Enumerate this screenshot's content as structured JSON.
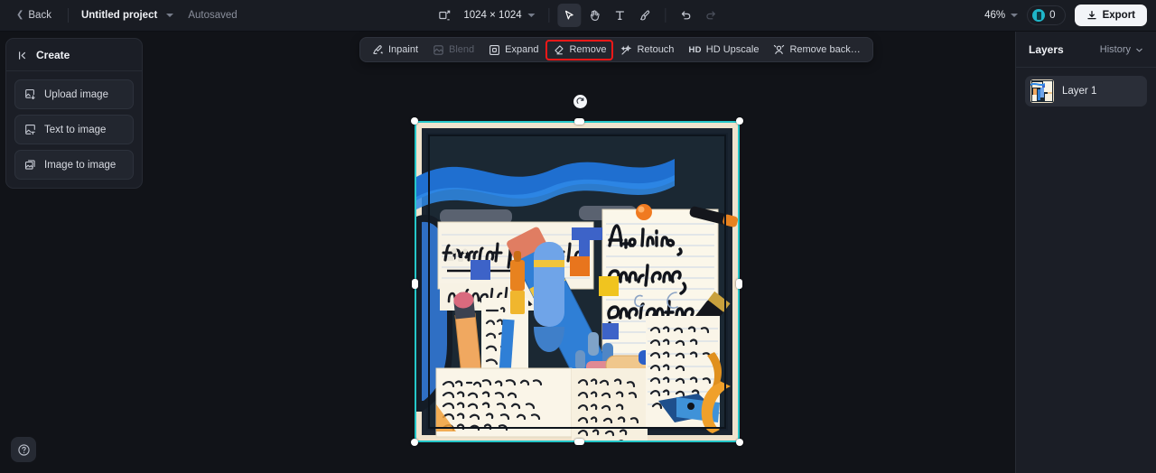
{
  "topbar": {
    "back_label": "Back",
    "project_name": "Untitled project",
    "autosave_label": "Autosaved",
    "canvas_size": "1024 × 1024",
    "zoom_level": "46%",
    "credits": "0",
    "export_label": "Export",
    "icons": {
      "resize": "resize-canvas-icon",
      "select": "select-arrow-icon",
      "hand": "hand-pan-icon",
      "text": "text-tool-icon",
      "brush": "brush-tool-icon",
      "undo": "undo-icon",
      "redo": "redo-icon"
    }
  },
  "toolstrip": {
    "tools": [
      {
        "label": "Inpaint",
        "icon": "inpaint-icon",
        "state": "enabled"
      },
      {
        "label": "Blend",
        "icon": "blend-icon",
        "state": "disabled"
      },
      {
        "label": "Expand",
        "icon": "expand-icon",
        "state": "enabled"
      },
      {
        "label": "Remove",
        "icon": "remove-eraser-icon",
        "state": "highlighted"
      },
      {
        "label": "Retouch",
        "icon": "retouch-wand-icon",
        "state": "enabled"
      },
      {
        "label": "HD Upscale",
        "icon": "hd-upscale-icon",
        "state": "enabled"
      },
      {
        "label": "Remove back…",
        "icon": "remove-background-icon",
        "state": "enabled"
      }
    ],
    "highlight_color": "#f01818"
  },
  "left_panel": {
    "title": "Create",
    "collapse_icon": "collapse-panel-icon",
    "buttons": [
      {
        "label": "Upload image",
        "icon": "upload-image-icon"
      },
      {
        "label": "Text to image",
        "icon": "text-to-image-icon"
      },
      {
        "label": "Image to image",
        "icon": "image-to-image-icon"
      }
    ]
  },
  "right_panel": {
    "title": "Layers",
    "history_label": "History",
    "history_icon": "chevron-down-icon",
    "layers": [
      {
        "name": "Layer 1",
        "selected": true
      }
    ]
  },
  "canvas": {
    "selection_color": "#25c7c9",
    "background": "#111318",
    "rotate_icon": "rotate-handle-icon",
    "artwork_description": "desk flatlay with notes, pencils and handwritten text",
    "artwork_text": {
      "headline_left": "tincrl peutnide",
      "headline_right": "A=elits,",
      "subline_right_1": "omenarg",
      "subline_right_2": "gonealhs",
      "note_small": "agnailly"
    }
  },
  "help": {
    "icon": "help-question-icon",
    "label": "?"
  }
}
